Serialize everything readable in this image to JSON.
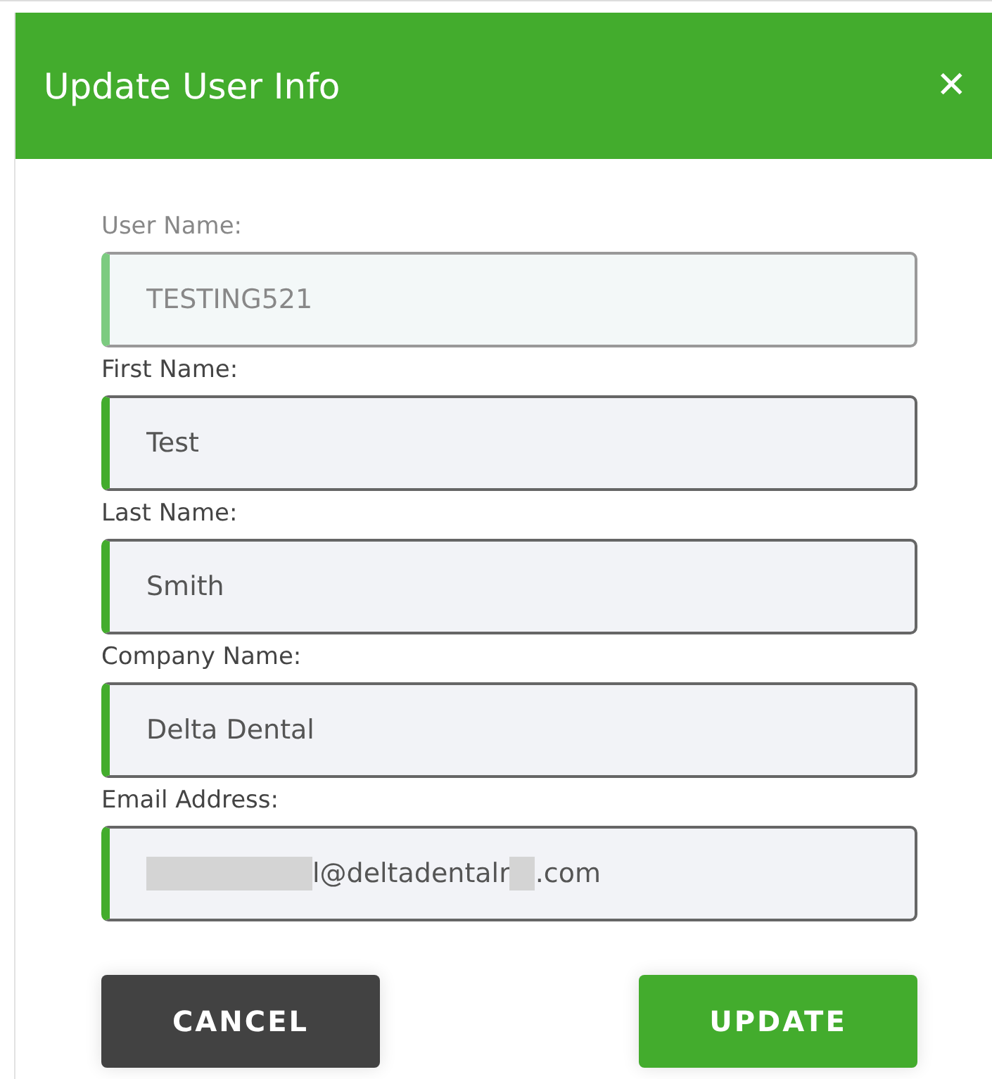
{
  "dialog": {
    "title": "Update User Info",
    "close": "✕"
  },
  "fields": [
    {
      "label": "User Name:",
      "value": "TESTING521",
      "disabled": true
    },
    {
      "label": "First Name:",
      "value": "Test",
      "disabled": false
    },
    {
      "label": "Last Name:",
      "value": "Smith",
      "disabled": false
    },
    {
      "label": "Company Name:",
      "value": "Delta Dental",
      "disabled": false
    },
    {
      "label": "Email Address:",
      "disabled": false,
      "value_parts": [
        {
          "kind": "redacted"
        },
        {
          "kind": "text",
          "text": "l@deltadentalr"
        },
        {
          "kind": "redacted"
        },
        {
          "kind": "text",
          "text": ".com"
        }
      ]
    }
  ],
  "buttons": [
    {
      "label": "CANCEL",
      "kind": "secondary"
    },
    {
      "label": "UPDATE",
      "kind": "primary"
    }
  ]
}
